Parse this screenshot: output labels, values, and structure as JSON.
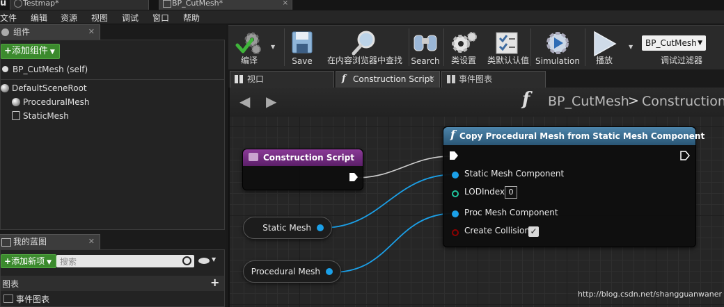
{
  "titlebar": {
    "tabs": [
      {
        "label": "Testmap*"
      },
      {
        "label": "BP_CutMesh*",
        "close": "×"
      }
    ]
  },
  "menu": {
    "items": [
      "文件",
      "编辑",
      "资源",
      "视图",
      "调试",
      "窗口",
      "帮助"
    ]
  },
  "components": {
    "tab_label": "组件",
    "add_button": "添加组件",
    "self_item": "BP_CutMesh (self)",
    "tree": [
      "DefaultSceneRoot",
      "ProceduralMesh",
      "StaticMesh"
    ]
  },
  "my_blueprint": {
    "tab_label": "我的蓝图",
    "add_button": "添加新项",
    "search_placeholder": "搜索",
    "section_title": "图表",
    "graph_item": "事件图表"
  },
  "toolbar": {
    "compile": "编译",
    "save": "Save",
    "find_in_browser": "在内容浏览器中查找",
    "search": "Search",
    "class_settings": "类设置",
    "class_defaults": "类默认认值",
    "simulation": "Simulation",
    "play": "播放",
    "debug_object": "BP_CutMesh",
    "debug_filter": "调试过滤器"
  },
  "graph_tabs": [
    {
      "label": "视口",
      "icon": "viewport-icon"
    },
    {
      "label": "Construction Script",
      "icon": "function-icon"
    },
    {
      "label": "事件图表",
      "icon": "graph-icon"
    }
  ],
  "breadcrumb": {
    "blueprint": "BP_CutMesh",
    "separator": ">",
    "graph": "Construction Script"
  },
  "nodes": {
    "construction_script": {
      "title": "Construction Script",
      "header_color": "#7a2f86"
    },
    "copy_mesh": {
      "title": "Copy Procedural Mesh from Static Mesh Component",
      "header_color": "#3a6c8e",
      "pins": {
        "static_mesh": "Static Mesh Component",
        "lod_index": "LODIndex",
        "lod_value": "0",
        "proc_mesh": "Proc Mesh Component",
        "create_collision": "Create Collision"
      }
    },
    "static_mesh_var": {
      "label": "Static Mesh"
    },
    "procedural_mesh_var": {
      "label": "Procedural Mesh"
    }
  },
  "colors": {
    "object_pin": "#1ba0e8",
    "int_pin": "#20c8a0",
    "bool_pin": "#8e0000",
    "exec_wire": "#cfcfcf"
  },
  "watermark": "http://blog.csdn.net/shangguanwaner"
}
